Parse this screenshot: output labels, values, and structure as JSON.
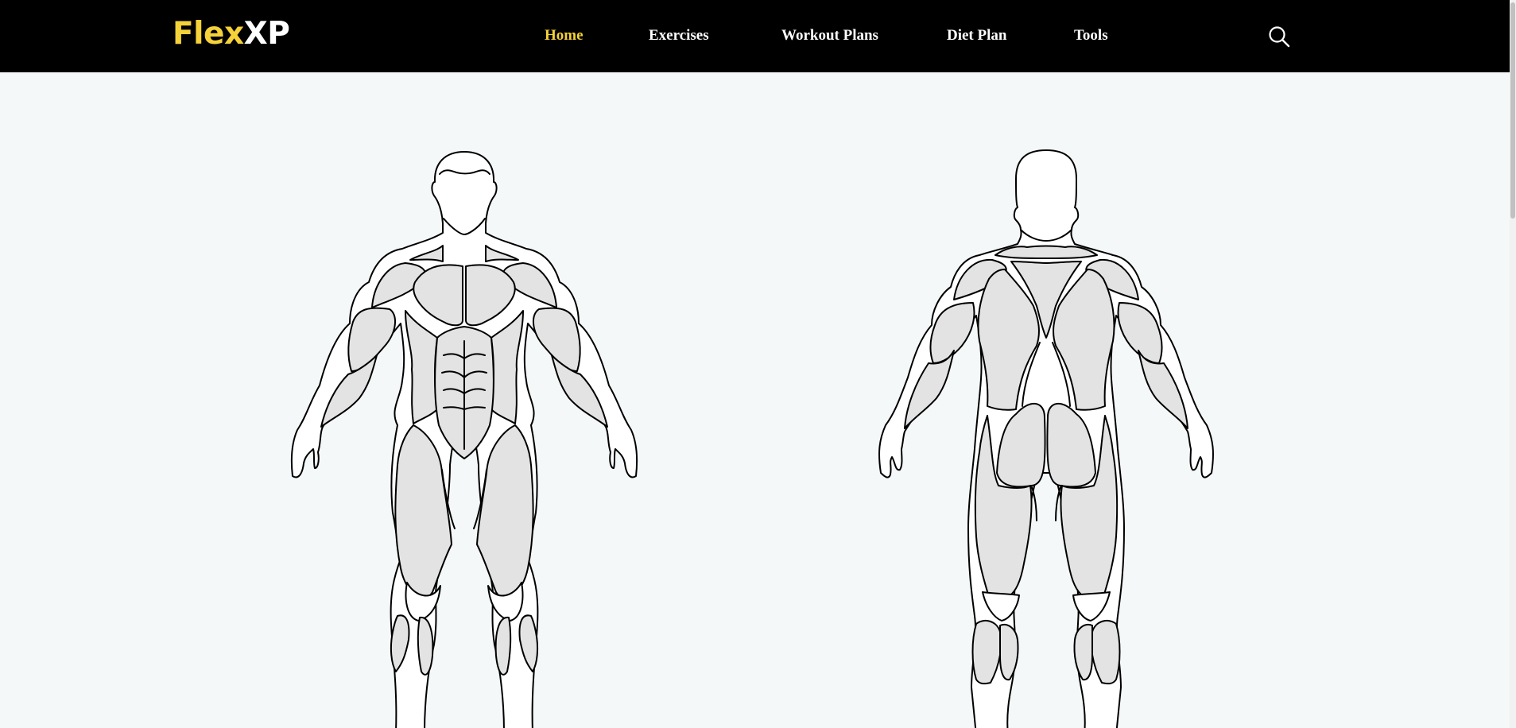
{
  "brand": {
    "part1": "Flex",
    "part2": "XP"
  },
  "nav": {
    "items": [
      "Home",
      "Exercises",
      "Workout Plans",
      "Diet Plan",
      "Tools"
    ],
    "active": "Home"
  },
  "icons": {
    "search": "search-icon"
  },
  "colors": {
    "navbar": "#000000",
    "accent": "#f5d13a",
    "background": "#f4f8f9",
    "muscle_fill": "#e3e3e3"
  }
}
